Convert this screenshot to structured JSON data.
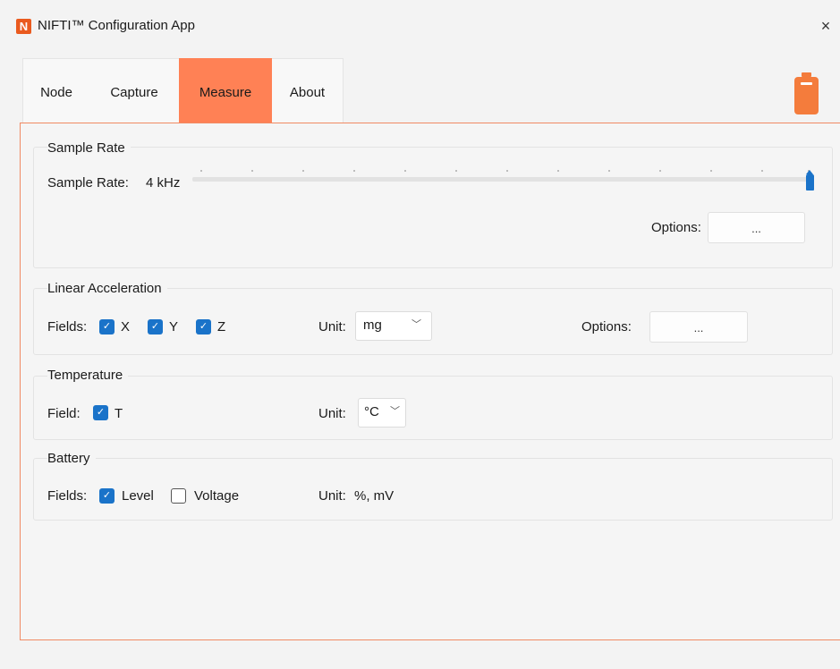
{
  "window": {
    "logo_letter": "N",
    "title": "NIFTI™ Configuration App",
    "close_glyph": "×"
  },
  "tabs": [
    {
      "label": "Node",
      "active": false
    },
    {
      "label": "Capture",
      "active": false
    },
    {
      "label": "Measure",
      "active": true
    },
    {
      "label": "About",
      "active": false
    }
  ],
  "status": {
    "battery_icon": "battery-icon",
    "battery_color": "#f47c3c"
  },
  "sample_rate": {
    "title": "Sample Rate",
    "label": "Sample Rate:",
    "value": "4 kHz",
    "slider_level": 1.0,
    "options_label": "Options:",
    "options_button": "..."
  },
  "linear_acceleration": {
    "title": "Linear Acceleration",
    "fields_label": "Fields:",
    "fields": [
      {
        "label": "X",
        "checked": true
      },
      {
        "label": "Y",
        "checked": true
      },
      {
        "label": "Z",
        "checked": true
      }
    ],
    "unit_label": "Unit:",
    "unit_value": "mg",
    "options_label": "Options:",
    "options_button": "..."
  },
  "temperature": {
    "title": "Temperature",
    "field_label": "Field:",
    "fields": [
      {
        "label": "T",
        "checked": true
      }
    ],
    "unit_label": "Unit:",
    "unit_value": "°C"
  },
  "battery": {
    "title": "Battery",
    "fields_label": "Fields:",
    "fields": [
      {
        "label": "Level",
        "checked": true
      },
      {
        "label": "Voltage",
        "checked": false
      }
    ],
    "unit_label": "Unit:",
    "unit_value": "%, mV"
  },
  "icons": {
    "check": "✓",
    "chevron": "﹀"
  },
  "colors": {
    "accent": "#ff8155",
    "checkbox": "#1a73c9",
    "logo": "#ea5a1e"
  }
}
